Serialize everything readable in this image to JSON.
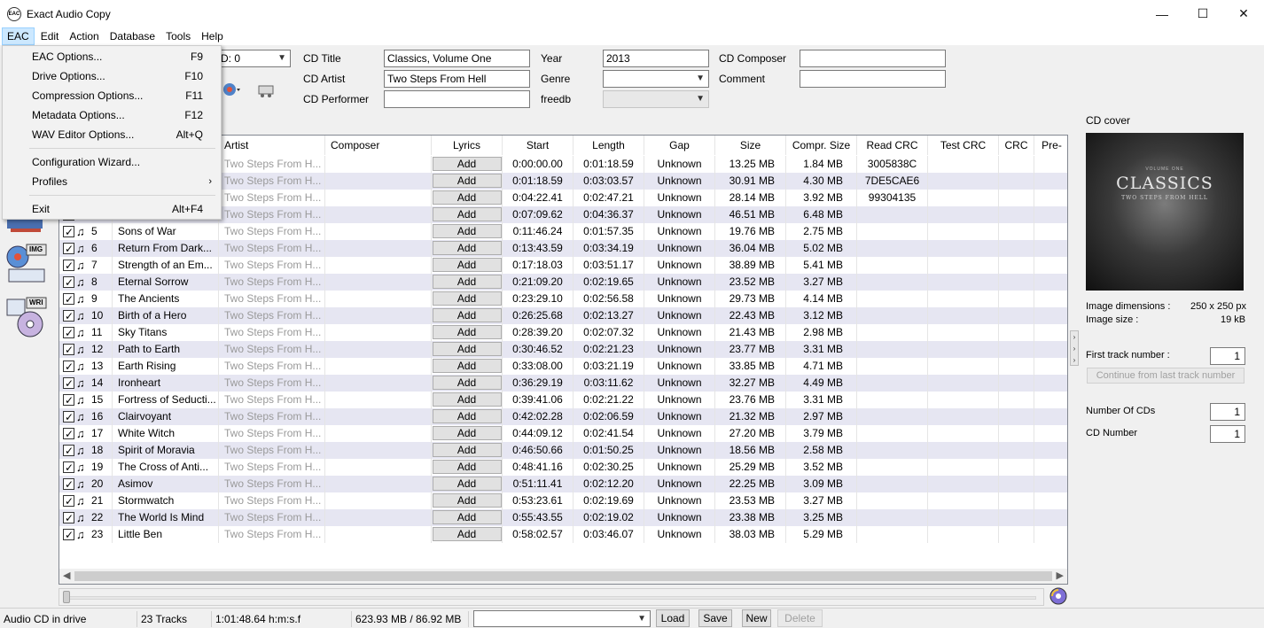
{
  "window": {
    "title": "Exact Audio Copy",
    "app_icon_text": "EAC"
  },
  "menubar": [
    "EAC",
    "Edit",
    "Action",
    "Database",
    "Tools",
    "Help"
  ],
  "eac_menu": [
    {
      "label": "EAC Options...",
      "key": "F9"
    },
    {
      "label": "Drive Options...",
      "key": "F10"
    },
    {
      "label": "Compression Options...",
      "key": "F11"
    },
    {
      "label": "Metadata Options...",
      "key": "F12"
    },
    {
      "label": "WAV Editor Options...",
      "key": "Alt+Q"
    },
    {
      "label": "Configuration Wizard...",
      "key": ""
    },
    {
      "label": "Profiles",
      "key": ""
    },
    {
      "label": "Exit",
      "key": "Alt+F4"
    }
  ],
  "drive_select": "D: 0",
  "cd_info": {
    "title_label": "CD Title",
    "title_value": "Classics, Volume One",
    "artist_label": "CD Artist",
    "artist_value": "Two Steps From Hell",
    "performer_label": "CD Performer",
    "performer_value": "",
    "year_label": "Year",
    "year_value": "2013",
    "genre_label": "Genre",
    "genre_value": "",
    "freedb_label": "freedb",
    "freedb_value": "",
    "composer_label": "CD Composer",
    "composer_value": "",
    "comment_label": "Comment",
    "comment_value": ""
  },
  "left_icons": [
    "IMG",
    "WRI"
  ],
  "table": {
    "columns": [
      "Artist",
      "Composer",
      "Lyrics",
      "Start",
      "Length",
      "Gap",
      "Size",
      "Compr. Size",
      "Read CRC",
      "Test CRC",
      "CRC",
      "Pre-"
    ],
    "add_label": "Add",
    "rows": [
      {
        "num": "",
        "title": "",
        "artist": "Two Steps From H...",
        "start": "0:00:00.00",
        "length": "0:01:18.59",
        "gap": "Unknown",
        "size": "13.25 MB",
        "compr": "1.84 MB",
        "readcrc": "3005838C"
      },
      {
        "num": "",
        "title": "",
        "artist": "Two Steps From H...",
        "start": "0:01:18.59",
        "length": "0:03:03.57",
        "gap": "Unknown",
        "size": "30.91 MB",
        "compr": "4.30 MB",
        "readcrc": "7DE5CAE6"
      },
      {
        "num": "",
        "title": "",
        "artist": "Two Steps From H...",
        "start": "0:04:22.41",
        "length": "0:02:47.21",
        "gap": "Unknown",
        "size": "28.14 MB",
        "compr": "3.92 MB",
        "readcrc": "99304135"
      },
      {
        "num": "",
        "title": "",
        "artist": "Two Steps From H...",
        "start": "0:07:09.62",
        "length": "0:04:36.37",
        "gap": "Unknown",
        "size": "46.51 MB",
        "compr": "6.48 MB",
        "readcrc": ""
      },
      {
        "num": "5",
        "title": "Sons of War",
        "artist": "Two Steps From H...",
        "start": "0:11:46.24",
        "length": "0:01:57.35",
        "gap": "Unknown",
        "size": "19.76 MB",
        "compr": "2.75 MB",
        "readcrc": ""
      },
      {
        "num": "6",
        "title": "Return From Dark...",
        "artist": "Two Steps From H...",
        "start": "0:13:43.59",
        "length": "0:03:34.19",
        "gap": "Unknown",
        "size": "36.04 MB",
        "compr": "5.02 MB",
        "readcrc": ""
      },
      {
        "num": "7",
        "title": "Strength of an Em...",
        "artist": "Two Steps From H...",
        "start": "0:17:18.03",
        "length": "0:03:51.17",
        "gap": "Unknown",
        "size": "38.89 MB",
        "compr": "5.41 MB",
        "readcrc": ""
      },
      {
        "num": "8",
        "title": "Eternal Sorrow",
        "artist": "Two Steps From H...",
        "start": "0:21:09.20",
        "length": "0:02:19.65",
        "gap": "Unknown",
        "size": "23.52 MB",
        "compr": "3.27 MB",
        "readcrc": ""
      },
      {
        "num": "9",
        "title": "The Ancients",
        "artist": "Two Steps From H...",
        "start": "0:23:29.10",
        "length": "0:02:56.58",
        "gap": "Unknown",
        "size": "29.73 MB",
        "compr": "4.14 MB",
        "readcrc": ""
      },
      {
        "num": "10",
        "title": "Birth of a Hero",
        "artist": "Two Steps From H...",
        "start": "0:26:25.68",
        "length": "0:02:13.27",
        "gap": "Unknown",
        "size": "22.43 MB",
        "compr": "3.12 MB",
        "readcrc": ""
      },
      {
        "num": "11",
        "title": "Sky Titans",
        "artist": "Two Steps From H...",
        "start": "0:28:39.20",
        "length": "0:02:07.32",
        "gap": "Unknown",
        "size": "21.43 MB",
        "compr": "2.98 MB",
        "readcrc": ""
      },
      {
        "num": "12",
        "title": "Path to Earth",
        "artist": "Two Steps From H...",
        "start": "0:30:46.52",
        "length": "0:02:21.23",
        "gap": "Unknown",
        "size": "23.77 MB",
        "compr": "3.31 MB",
        "readcrc": ""
      },
      {
        "num": "13",
        "title": "Earth Rising",
        "artist": "Two Steps From H...",
        "start": "0:33:08.00",
        "length": "0:03:21.19",
        "gap": "Unknown",
        "size": "33.85 MB",
        "compr": "4.71 MB",
        "readcrc": ""
      },
      {
        "num": "14",
        "title": "Ironheart",
        "artist": "Two Steps From H...",
        "start": "0:36:29.19",
        "length": "0:03:11.62",
        "gap": "Unknown",
        "size": "32.27 MB",
        "compr": "4.49 MB",
        "readcrc": ""
      },
      {
        "num": "15",
        "title": "Fortress of Seducti...",
        "artist": "Two Steps From H...",
        "start": "0:39:41.06",
        "length": "0:02:21.22",
        "gap": "Unknown",
        "size": "23.76 MB",
        "compr": "3.31 MB",
        "readcrc": ""
      },
      {
        "num": "16",
        "title": "Clairvoyant",
        "artist": "Two Steps From H...",
        "start": "0:42:02.28",
        "length": "0:02:06.59",
        "gap": "Unknown",
        "size": "21.32 MB",
        "compr": "2.97 MB",
        "readcrc": ""
      },
      {
        "num": "17",
        "title": "White Witch",
        "artist": "Two Steps From H...",
        "start": "0:44:09.12",
        "length": "0:02:41.54",
        "gap": "Unknown",
        "size": "27.20 MB",
        "compr": "3.79 MB",
        "readcrc": ""
      },
      {
        "num": "18",
        "title": "Spirit of Moravia",
        "artist": "Two Steps From H...",
        "start": "0:46:50.66",
        "length": "0:01:50.25",
        "gap": "Unknown",
        "size": "18.56 MB",
        "compr": "2.58 MB",
        "readcrc": ""
      },
      {
        "num": "19",
        "title": "The Cross of Anti...",
        "artist": "Two Steps From H...",
        "start": "0:48:41.16",
        "length": "0:02:30.25",
        "gap": "Unknown",
        "size": "25.29 MB",
        "compr": "3.52 MB",
        "readcrc": ""
      },
      {
        "num": "20",
        "title": "Asimov",
        "artist": "Two Steps From H...",
        "start": "0:51:11.41",
        "length": "0:02:12.20",
        "gap": "Unknown",
        "size": "22.25 MB",
        "compr": "3.09 MB",
        "readcrc": ""
      },
      {
        "num": "21",
        "title": "Stormwatch",
        "artist": "Two Steps From H...",
        "start": "0:53:23.61",
        "length": "0:02:19.69",
        "gap": "Unknown",
        "size": "23.53 MB",
        "compr": "3.27 MB",
        "readcrc": ""
      },
      {
        "num": "22",
        "title": "The World Is Mind",
        "artist": "Two Steps From H...",
        "start": "0:55:43.55",
        "length": "0:02:19.02",
        "gap": "Unknown",
        "size": "23.38 MB",
        "compr": "3.25 MB",
        "readcrc": ""
      },
      {
        "num": "23",
        "title": "Little Ben",
        "artist": "Two Steps From H...",
        "start": "0:58:02.57",
        "length": "0:03:46.07",
        "gap": "Unknown",
        "size": "38.03 MB",
        "compr": "5.29 MB",
        "readcrc": ""
      }
    ]
  },
  "cover": {
    "label": "CD cover",
    "art_title": "CLASSICS",
    "art_subtitle": "TWO STEPS FROM HELL",
    "art_volume": "VOLUME ONE",
    "dim_label": "Image dimensions :",
    "dim_value": "250 x 250 px",
    "size_label": "Image size :",
    "size_value": "19 kB"
  },
  "right_panel": {
    "first_track_label": "First track number :",
    "first_track_value": "1",
    "continue_label": "Continue from last track number",
    "num_cds_label": "Number Of CDs",
    "num_cds_value": "1",
    "cd_number_label": "CD Number",
    "cd_number_value": "1"
  },
  "statusbar": {
    "drive_status": "Audio CD in drive",
    "tracks": "23 Tracks",
    "duration": "1:01:48.64 h:m:s.f",
    "size": "623.93 MB /  86.92 MB",
    "profile": "",
    "load": "Load",
    "save": "Save",
    "new": "New",
    "delete": "Delete"
  }
}
